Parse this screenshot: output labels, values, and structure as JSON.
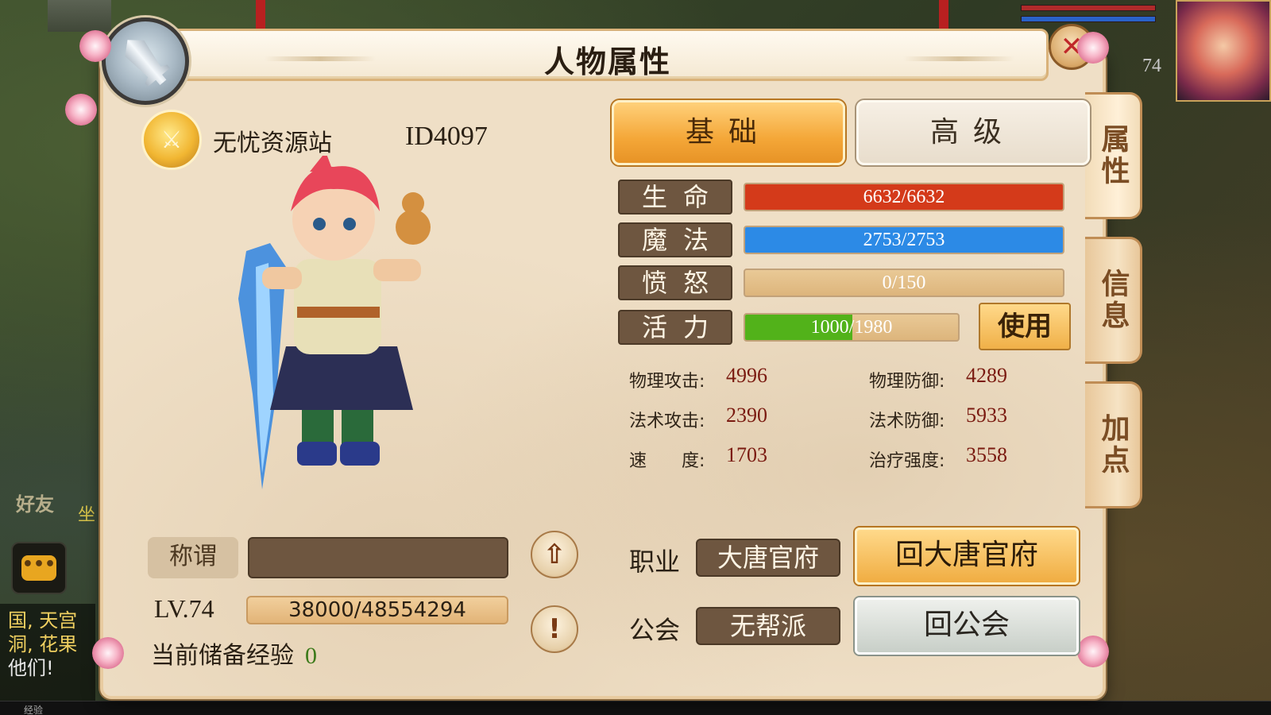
{
  "background": {
    "top_level": "74",
    "friend_label": "好友",
    "friend_extra": "坐",
    "chat_lines": [
      "国, 天宫",
      "洞, 花果",
      "他们!"
    ],
    "bottom_label": "经验"
  },
  "panel": {
    "title": "人物属性",
    "close_icon": "close-icon"
  },
  "side_tabs": [
    {
      "label": "属性"
    },
    {
      "label": "信息"
    },
    {
      "label": "加点"
    }
  ],
  "character": {
    "name": "无忧资源站",
    "id": "ID4097",
    "title_label": "称谓",
    "title_value": "",
    "level": "LV.74",
    "exp": "38000/48554294",
    "reserve_label": "当前储备经验",
    "reserve_value": "0"
  },
  "tabs": {
    "basic": "基础",
    "advanced": "高级",
    "active": "basic"
  },
  "bars": [
    {
      "label": "生命",
      "text": "6632/6632",
      "fill": 1.0,
      "color": "#d43a1a"
    },
    {
      "label": "魔法",
      "text": "2753/2753",
      "fill": 1.0,
      "color": "#2c8ae6"
    },
    {
      "label": "愤怒",
      "text": "0/150",
      "fill": 0.0,
      "color": "#d9a040"
    },
    {
      "label": "活力",
      "text": "1000/1980",
      "fill": 0.505,
      "color": "#52b21a"
    }
  ],
  "use_button": "使用",
  "attributes": [
    {
      "label": "物理攻击:",
      "value": "4996"
    },
    {
      "label": "物理防御:",
      "value": "4289"
    },
    {
      "label": "法术攻击:",
      "value": "2390"
    },
    {
      "label": "法术防御:",
      "value": "5933"
    },
    {
      "label": "速　　度:",
      "value": "1703"
    },
    {
      "label": "治疗强度:",
      "value": "3558"
    }
  ],
  "career": {
    "label": "职业",
    "value": "大唐官府",
    "button": "回大唐官府"
  },
  "guild": {
    "label": "公会",
    "value": "无帮派",
    "button": "回公会"
  }
}
